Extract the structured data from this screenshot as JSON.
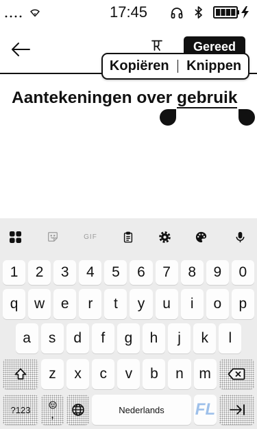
{
  "status_bar": {
    "time": "17:45",
    "battery_level": 1.0,
    "icons": [
      "signal-icon",
      "wifi-icon",
      "headphones-icon",
      "bluetooth-icon",
      "battery-icon",
      "charging-bolt-icon"
    ]
  },
  "toolbar": {
    "icons": [
      "arrow-left-icon",
      "text-style-icon"
    ],
    "done_label": "Gereed"
  },
  "selection_menu": {
    "copy_label": "Kopiëren",
    "cut_label": "Knippen"
  },
  "note": {
    "title_start": "Aantekeningen over ",
    "title_selected": "gebruik"
  },
  "keyboard": {
    "toolbar": {
      "icons": [
        "apps-grid-icon",
        "sticker-icon",
        "gif-icon",
        "clipboard-icon",
        "settings-gear-icon",
        "palette-icon",
        "microphone-icon"
      ],
      "gif_label": "GIF"
    },
    "number_row": [
      "1",
      "2",
      "3",
      "4",
      "5",
      "6",
      "7",
      "8",
      "9",
      "0"
    ],
    "letter_rows": [
      [
        "q",
        "w",
        "e",
        "r",
        "t",
        "y",
        "u",
        "i",
        "o",
        "p"
      ],
      [
        "a",
        "s",
        "d",
        "f",
        "g",
        "h",
        "j",
        "k",
        "l"
      ],
      [
        "z",
        "x",
        "c",
        "v",
        "b",
        "n",
        "m"
      ]
    ],
    "bottom_row": {
      "symbols_label": "?123",
      "comma_label": ",",
      "space_label": "Nederlands",
      "watermark": "FL"
    },
    "function_icons": [
      "shift-icon",
      "backspace-icon",
      "emoji-icon",
      "globe-icon",
      "tab-arrow-icon"
    ]
  },
  "colors": {
    "text": "#111111",
    "screen_background": "#ffffff",
    "keyboard_background": "#ececec",
    "key_background": "#fdfdfd",
    "disabled_icon": "#9b9b9b",
    "watermark": "#9ec0ea"
  }
}
